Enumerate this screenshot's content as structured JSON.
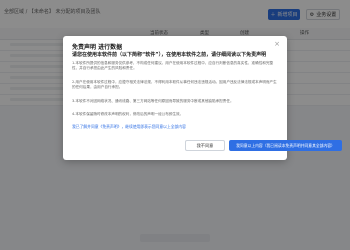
{
  "background": {
    "topbar_text": "全部区域 / 【未命名】 未分配的项目及团队",
    "primary_button": "新增项目",
    "secondary_button": "业务设置",
    "table_headers": [
      "当前状态",
      "类型",
      "创建",
      "操作"
    ]
  },
  "dialog": {
    "title": "免责声明 进行数据",
    "close_glyph": "×",
    "subtitle": "请您在使用本软件前（以下简称“软件”），在使用本软件之前，请仔细阅读以下免责声明",
    "paragraphs": [
      "1.本软件所提供的信息和服务仅供参考，不构成任何建议。用户在使用本软件过程中，应自行判断信息的真实性、准确性和完整性，并自行承担由此产生的风险和责任。",
      "2.用户在使用本软件过程中，应遵守相关法律法规，不得利用本软件从事任何违法违规活动。因用户违反法律法规或本声明而产生的任何后果，由用户自行承担。",
      "3.本软件不对因网络状况、通讯线路、第三方网站等任何原因而导致的服务中断或其他缺陷承担责任。",
      "4.本软件保留随时修改本声明的权利，修改后的声明一经公布即生效。"
    ],
    "agree_link": "我已了解并同意《免责声明》，继续使用即表示您同意以上全部内容",
    "decline_button": "我不同意",
    "accept_button": "我同意以上内容（我已阅读本免责声明并同意其全部内容）"
  }
}
